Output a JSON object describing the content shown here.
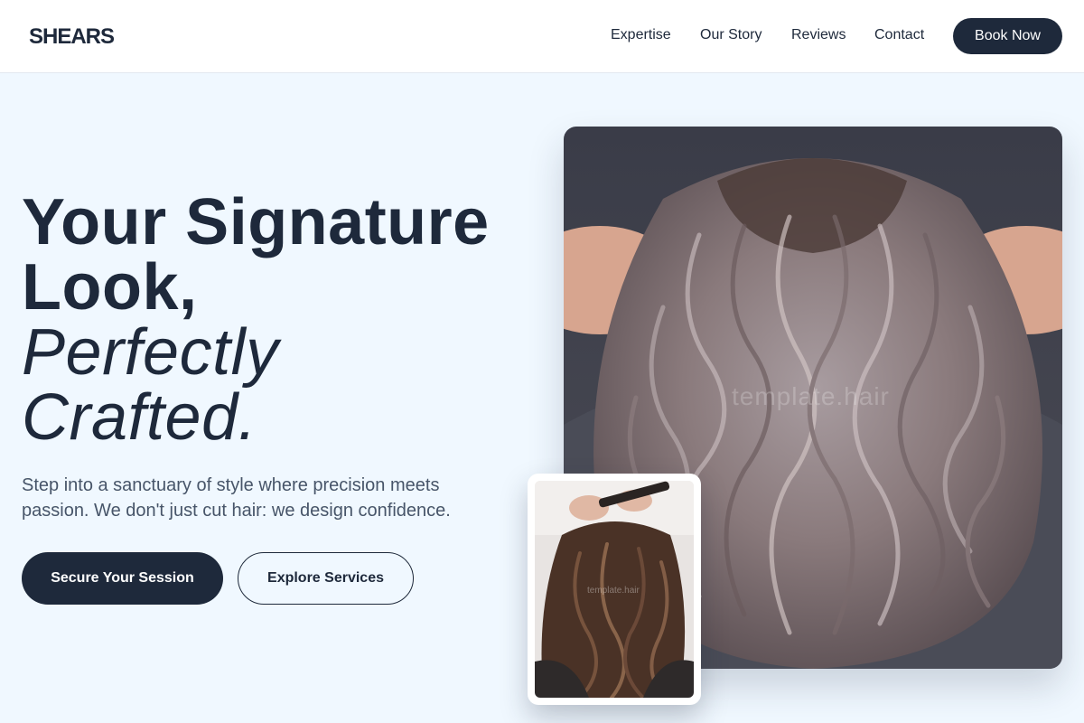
{
  "header": {
    "logo": "SHEARS",
    "nav": [
      "Expertise",
      "Our Story",
      "Reviews",
      "Contact"
    ],
    "cta": "Book Now"
  },
  "hero": {
    "headline_bold_1": "Your Signature",
    "headline_bold_2": "Look,",
    "headline_italic_1": "Perfectly",
    "headline_italic_2": "Crafted.",
    "subtext": "Step into a sanctuary of style where precision meets passion. We don't just cut hair: we design confidence.",
    "primary_button": "Secure Your Session",
    "secondary_button": "Explore Services"
  },
  "images": {
    "main_watermark": "template.hair",
    "small_watermark": "template.hair"
  },
  "colors": {
    "primary": "#1e293b",
    "background": "#f0f8ff",
    "text_muted": "#475569"
  }
}
